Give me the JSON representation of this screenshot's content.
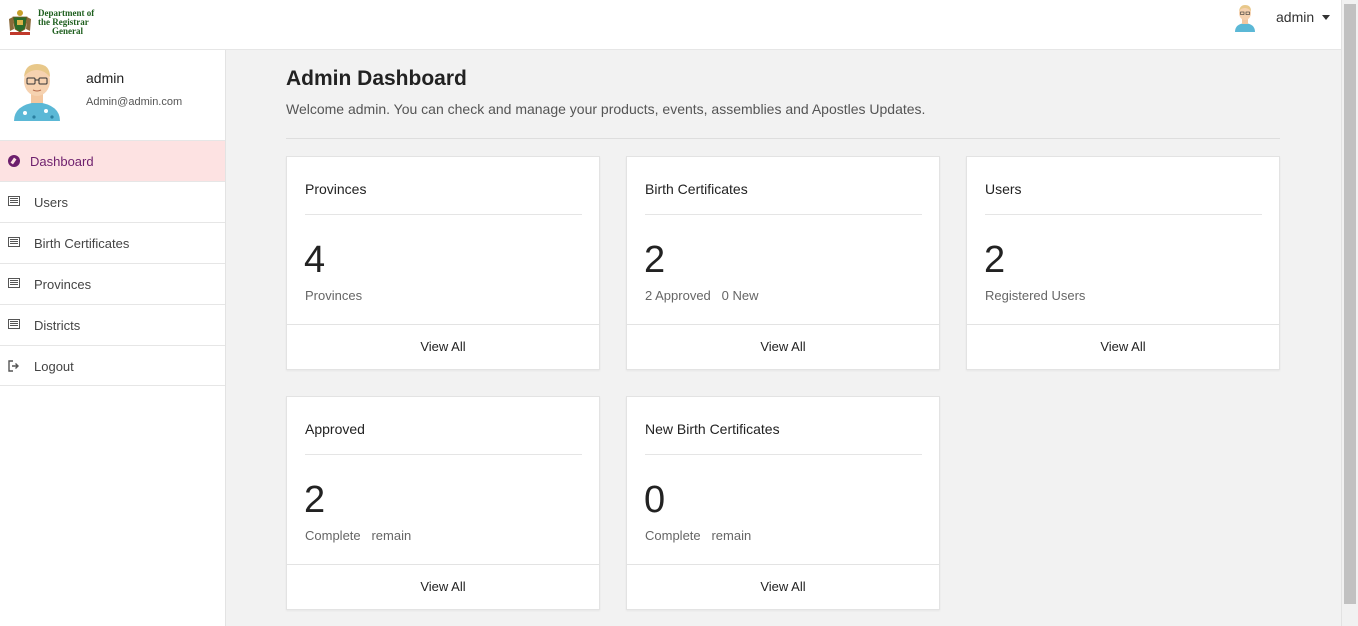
{
  "header": {
    "logo": {
      "line1": "Department of",
      "line2": "the Registrar",
      "line3": "General"
    },
    "user_name": "admin"
  },
  "sidebar": {
    "profile": {
      "name": "admin",
      "email": "Admin@admin.com"
    },
    "items": [
      {
        "label": "Dashboard",
        "icon": "compass-icon",
        "active": true
      },
      {
        "label": "Users",
        "icon": "list-icon"
      },
      {
        "label": "Birth Certificates",
        "icon": "list-icon"
      },
      {
        "label": "Provinces",
        "icon": "list-icon"
      },
      {
        "label": "Districts",
        "icon": "list-icon"
      },
      {
        "label": "Logout",
        "icon": "sign-out-icon"
      }
    ]
  },
  "main": {
    "title": "Admin Dashboard",
    "welcome": "Welcome admin. You can check and manage your products, events, assemblies and Apostles Updates.",
    "cards": [
      {
        "title": "Provinces",
        "value": "4",
        "subtitle": "Provinces",
        "action": "View All"
      },
      {
        "title": "Birth Certificates",
        "value": "2",
        "subtitle": "2 Approved   0 New",
        "action": "View All"
      },
      {
        "title": "Users",
        "value": "2",
        "subtitle": "Registered Users",
        "action": "View All"
      },
      {
        "title": "Approved",
        "value": "2",
        "subtitle": "Complete   remain",
        "action": "View All"
      },
      {
        "title": "New Birth Certificates",
        "value": "0",
        "subtitle": "Complete   remain",
        "action": "View All"
      }
    ]
  },
  "colors": {
    "active_bg": "#fde2e2",
    "active_text": "#6d1f6d",
    "logo_green": "#1d5e1d",
    "page_bg": "#f2f2f2"
  }
}
